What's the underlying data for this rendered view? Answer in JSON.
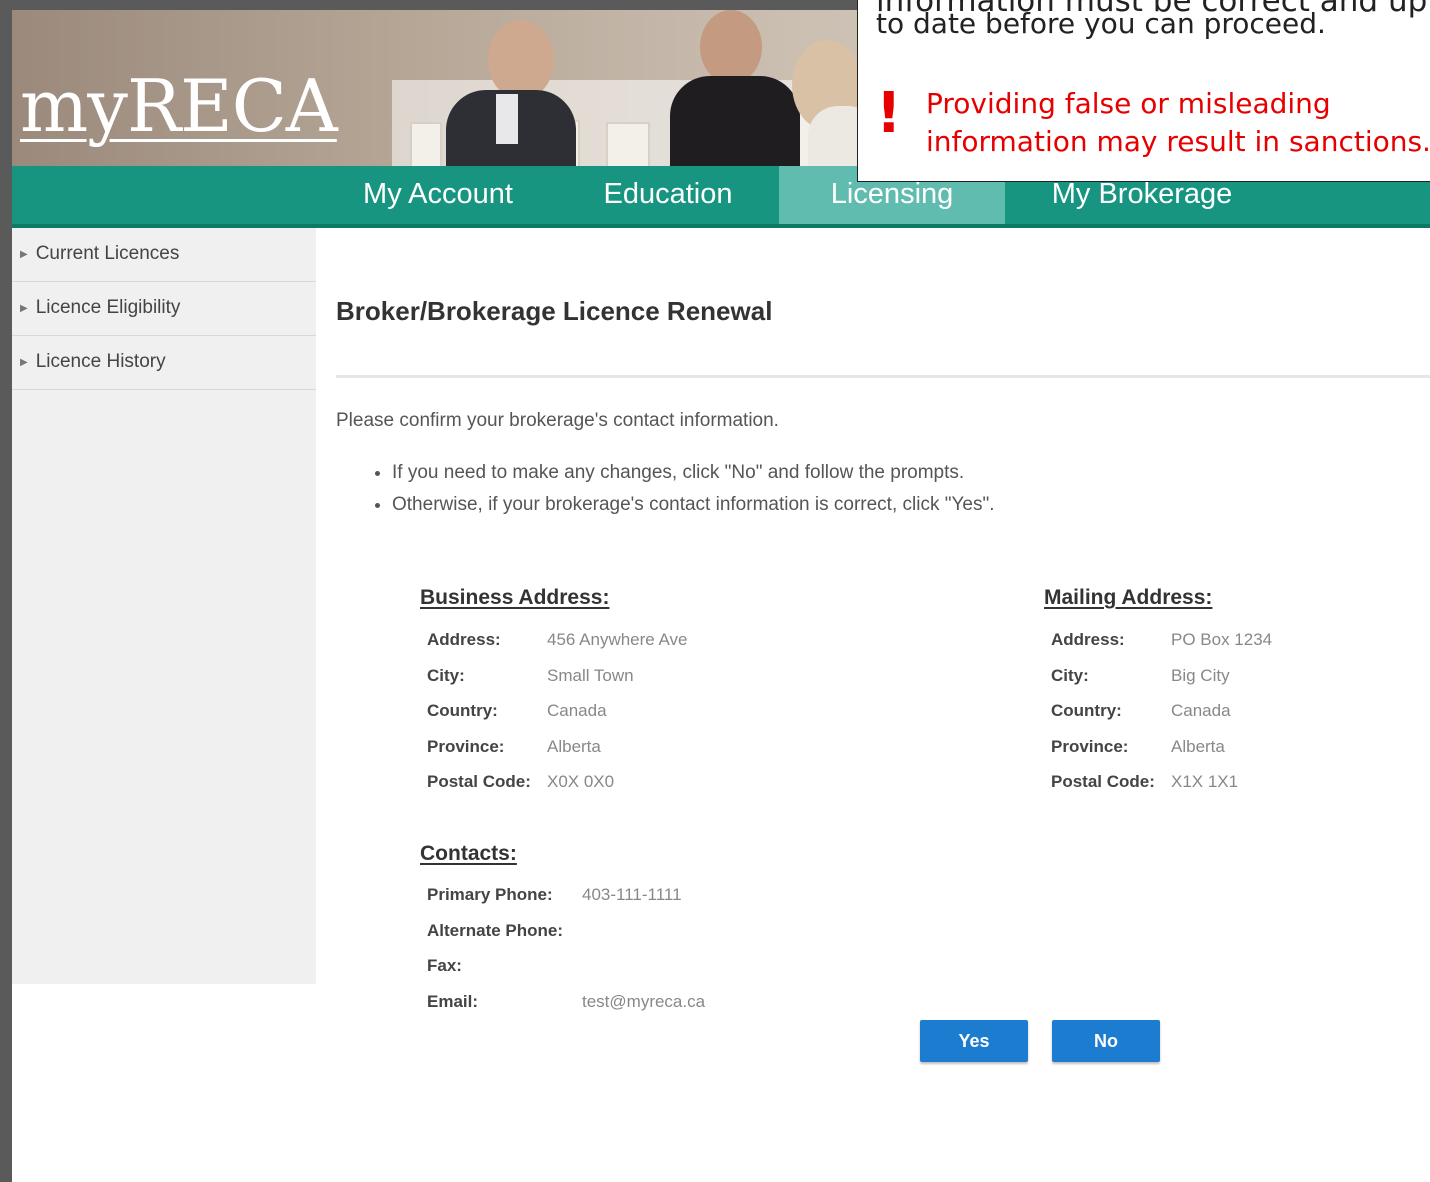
{
  "logo": "myRECA",
  "nav": [
    {
      "label": "My Account",
      "active": false
    },
    {
      "label": "Education",
      "active": false
    },
    {
      "label": "Licensing",
      "active": true
    },
    {
      "label": "My Brokerage",
      "active": false
    }
  ],
  "sidebar": {
    "items": [
      {
        "label": "Current Licences"
      },
      {
        "label": "Licence Eligibility"
      },
      {
        "label": "Licence History"
      }
    ]
  },
  "page": {
    "title": "Broker/Brokerage Licence Renewal",
    "intro": "Please confirm your brokerage's contact information.",
    "bullets": [
      "If you need to make any changes, click \"No\" and follow the prompts.",
      "Otherwise, if your brokerage's contact information is correct, click \"Yes\"."
    ]
  },
  "business_address": {
    "heading": "Business Address:",
    "rows": [
      {
        "label": "Address:",
        "value": "456 Anywhere Ave"
      },
      {
        "label": "City:",
        "value": "Small Town"
      },
      {
        "label": "Country:",
        "value": "Canada"
      },
      {
        "label": "Province:",
        "value": "Alberta"
      },
      {
        "label": "Postal Code:",
        "value": "X0X 0X0"
      }
    ]
  },
  "mailing_address": {
    "heading": "Mailing Address:",
    "rows": [
      {
        "label": "Address:",
        "value": "PO Box 1234"
      },
      {
        "label": "City:",
        "value": "Big City"
      },
      {
        "label": "Country:",
        "value": "Canada"
      },
      {
        "label": "Province:",
        "value": "Alberta"
      },
      {
        "label": "Postal Code:",
        "value": "X1X 1X1"
      }
    ]
  },
  "contacts": {
    "heading": "Contacts:",
    "rows": [
      {
        "label": "Primary Phone:",
        "value": "403-111-1111"
      },
      {
        "label": "Alternate Phone:",
        "value": ""
      },
      {
        "label": "Fax:",
        "value": ""
      },
      {
        "label": "Email:",
        "value": "test@myreca.ca"
      }
    ]
  },
  "buttons": {
    "yes": "Yes",
    "no": "No"
  },
  "callout": {
    "clipped_line": "information must be correct and up",
    "line2": "to date before you can proceed.",
    "icon": "!",
    "warning_line1": "Providing false or misleading",
    "warning_line2": "information may result in sanctions."
  },
  "colors": {
    "nav_bg": "#179580",
    "nav_active": "#61bcb0",
    "button": "#1c7cd0",
    "warning": "#e60000"
  }
}
